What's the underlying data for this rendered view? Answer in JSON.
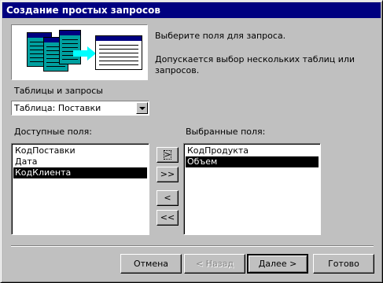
{
  "window": {
    "title": "Создание простых запросов"
  },
  "hints": {
    "line1": "Выберите поля для запроса.",
    "line2": "Допускается выбор нескольких таблиц или",
    "line3": "запросов."
  },
  "source": {
    "label": "Таблицы и запросы",
    "selected": "Таблица: Поставки"
  },
  "available": {
    "label": "Доступные поля:",
    "items": [
      "КодПоставки",
      "Дата",
      "КодКлиента"
    ],
    "selected_index": 2
  },
  "chosen": {
    "label": "Выбранные поля:",
    "items": [
      "КодПродукта",
      "Объем"
    ],
    "selected_index": 1
  },
  "move_buttons": {
    "add_one": ">",
    "add_all": ">>",
    "remove_one": "<",
    "remove_all": "<<"
  },
  "footer": {
    "cancel": "Отмена",
    "back": "< Назад",
    "next": "Далее >",
    "finish": "Готово"
  }
}
